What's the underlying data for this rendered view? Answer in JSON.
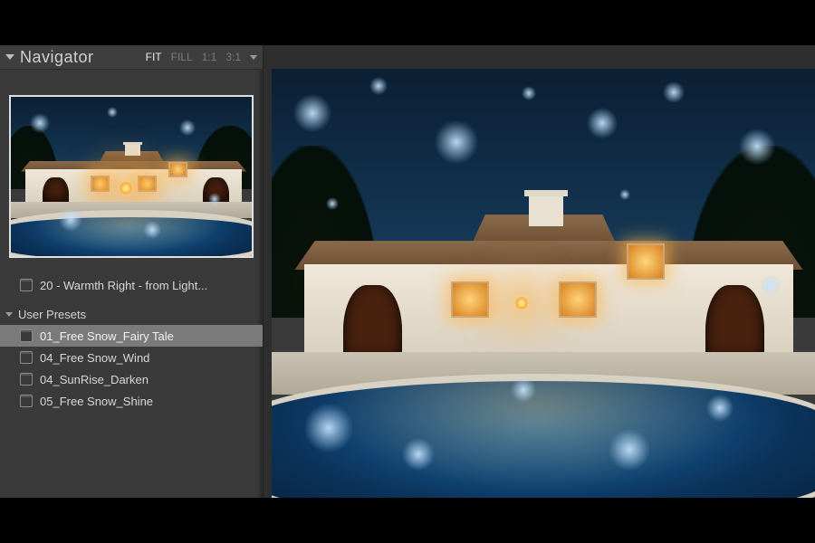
{
  "navigator": {
    "title": "Navigator",
    "zoom_options": [
      "FIT",
      "FILL",
      "1:1",
      "3:1"
    ],
    "zoom_selected": "FIT"
  },
  "orphan_preset": {
    "label": "20 - Warmth Right - from Light..."
  },
  "user_presets": {
    "section_label": "User Presets",
    "items": [
      {
        "label": "01_Free Snow_Fairy Tale",
        "selected": true
      },
      {
        "label": "04_Free Snow_Wind",
        "selected": false
      },
      {
        "label": "04_SunRise_Darken",
        "selected": false
      },
      {
        "label": "05_Free Snow_Shine",
        "selected": false
      }
    ]
  }
}
